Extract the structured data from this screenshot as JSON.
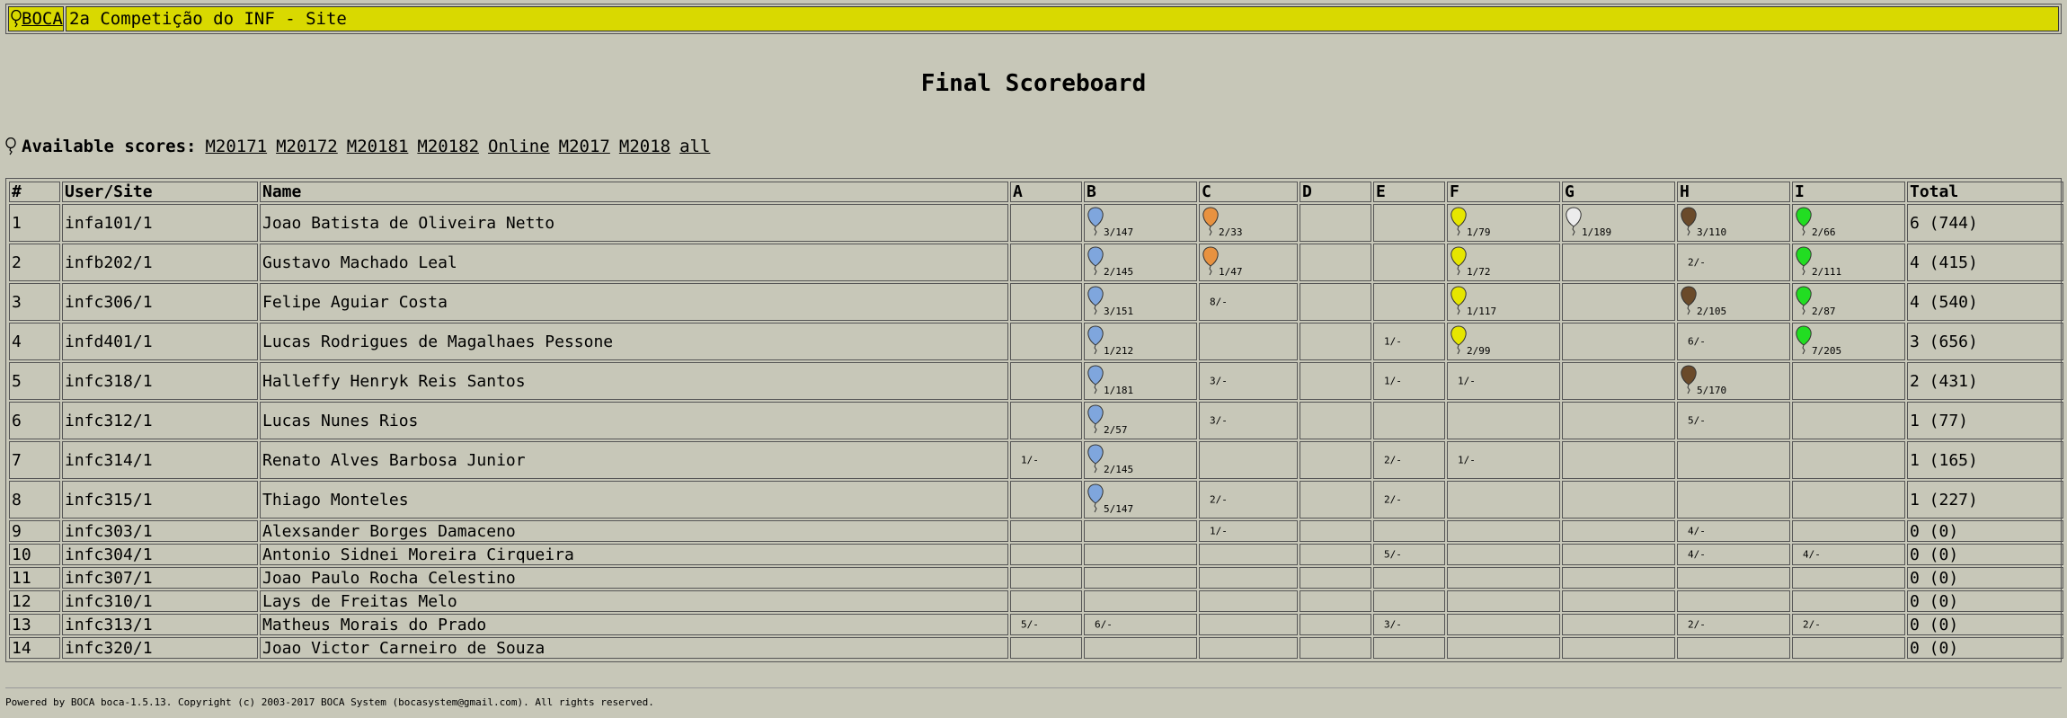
{
  "header": {
    "logo_label": "BOCA",
    "title": "2a Competição do INF - Site"
  },
  "page_title": "Final Scoreboard",
  "scores": {
    "label": "Available scores:",
    "links": [
      "M20171",
      "M20172",
      "M20181",
      "M20182",
      "Online",
      "M2017",
      "M2018",
      "all"
    ]
  },
  "colors": {
    "background": "#c7c7b8",
    "header_bar": "#d9d900",
    "B": "#7fa6dd",
    "C": "#e89240",
    "F": "#e6e600",
    "G": "#ececec",
    "H": "#6a4a2a",
    "I": "#22dd22"
  },
  "table": {
    "headers": [
      "#",
      "User/Site",
      "Name",
      "A",
      "B",
      "C",
      "D",
      "E",
      "F",
      "G",
      "H",
      "I",
      "Total"
    ],
    "problems": [
      "A",
      "B",
      "C",
      "D",
      "E",
      "F",
      "G",
      "H",
      "I"
    ],
    "rows": [
      {
        "rank": "1",
        "user": "infa101/1",
        "name": "Joao Batista de Oliveira Netto",
        "tall": true,
        "total": "6 (744)",
        "p": {
          "B": {
            "t": "3/147",
            "b": true
          },
          "C": {
            "t": "2/33",
            "b": true
          },
          "F": {
            "t": "1/79",
            "b": true
          },
          "G": {
            "t": "1/189",
            "b": true
          },
          "H": {
            "t": "3/110",
            "b": true
          },
          "I": {
            "t": "2/66",
            "b": true
          }
        }
      },
      {
        "rank": "2",
        "user": "infb202/1",
        "name": "Gustavo Machado Leal",
        "tall": true,
        "total": "4 (415)",
        "p": {
          "B": {
            "t": "2/145",
            "b": true
          },
          "C": {
            "t": "1/47",
            "b": true
          },
          "F": {
            "t": "1/72",
            "b": true
          },
          "H": {
            "t": "2/-",
            "b": false
          },
          "I": {
            "t": "2/111",
            "b": true
          }
        }
      },
      {
        "rank": "3",
        "user": "infc306/1",
        "name": "Felipe Aguiar Costa",
        "tall": true,
        "total": "4 (540)",
        "p": {
          "B": {
            "t": "3/151",
            "b": true
          },
          "C": {
            "t": "8/-",
            "b": false
          },
          "F": {
            "t": "1/117",
            "b": true
          },
          "H": {
            "t": "2/105",
            "b": true
          },
          "I": {
            "t": "2/87",
            "b": true
          }
        }
      },
      {
        "rank": "4",
        "user": "infd401/1",
        "name": "Lucas Rodrigues de Magalhaes Pessone",
        "tall": true,
        "total": "3 (656)",
        "p": {
          "B": {
            "t": "1/212",
            "b": true
          },
          "E": {
            "t": "1/-",
            "b": false
          },
          "F": {
            "t": "2/99",
            "b": true
          },
          "H": {
            "t": "6/-",
            "b": false
          },
          "I": {
            "t": "7/205",
            "b": true
          }
        }
      },
      {
        "rank": "5",
        "user": "infc318/1",
        "name": "Halleffy Henryk Reis Santos",
        "tall": true,
        "total": "2 (431)",
        "p": {
          "B": {
            "t": "1/181",
            "b": true
          },
          "C": {
            "t": "3/-",
            "b": false
          },
          "E": {
            "t": "1/-",
            "b": false
          },
          "F": {
            "t": "1/-",
            "b": false
          },
          "H": {
            "t": "5/170",
            "b": true
          }
        }
      },
      {
        "rank": "6",
        "user": "infc312/1",
        "name": "Lucas Nunes Rios",
        "tall": true,
        "total": "1 (77)",
        "p": {
          "B": {
            "t": "2/57",
            "b": true
          },
          "C": {
            "t": "3/-",
            "b": false
          },
          "H": {
            "t": "5/-",
            "b": false
          }
        }
      },
      {
        "rank": "7",
        "user": "infc314/1",
        "name": "Renato Alves Barbosa Junior",
        "tall": true,
        "total": "1 (165)",
        "p": {
          "A": {
            "t": "1/-",
            "b": false
          },
          "B": {
            "t": "2/145",
            "b": true
          },
          "E": {
            "t": "2/-",
            "b": false
          },
          "F": {
            "t": "1/-",
            "b": false
          }
        }
      },
      {
        "rank": "8",
        "user": "infc315/1",
        "name": "Thiago Monteles",
        "tall": true,
        "total": "1 (227)",
        "p": {
          "B": {
            "t": "5/147",
            "b": true
          },
          "C": {
            "t": "2/-",
            "b": false
          },
          "E": {
            "t": "2/-",
            "b": false
          }
        }
      },
      {
        "rank": "9",
        "user": "infc303/1",
        "name": "Alexsander Borges Damaceno",
        "tall": false,
        "total": "0 (0)",
        "p": {
          "C": {
            "t": "1/-",
            "b": false
          },
          "H": {
            "t": "4/-",
            "b": false
          }
        }
      },
      {
        "rank": "10",
        "user": "infc304/1",
        "name": "Antonio Sidnei Moreira Cirqueira",
        "tall": false,
        "total": "0 (0)",
        "p": {
          "E": {
            "t": "5/-",
            "b": false
          },
          "H": {
            "t": "4/-",
            "b": false
          },
          "I": {
            "t": "4/-",
            "b": false
          }
        }
      },
      {
        "rank": "11",
        "user": "infc307/1",
        "name": "Joao Paulo Rocha Celestino",
        "tall": false,
        "total": "0 (0)",
        "p": {}
      },
      {
        "rank": "12",
        "user": "infc310/1",
        "name": "Lays de Freitas Melo",
        "tall": false,
        "total": "0 (0)",
        "p": {}
      },
      {
        "rank": "13",
        "user": "infc313/1",
        "name": "Matheus Morais do Prado",
        "tall": false,
        "total": "0 (0)",
        "p": {
          "A": {
            "t": "5/-",
            "b": false
          },
          "B": {
            "t": "6/-",
            "b": false
          },
          "E": {
            "t": "3/-",
            "b": false
          },
          "H": {
            "t": "2/-",
            "b": false
          },
          "I": {
            "t": "2/-",
            "b": false
          }
        }
      },
      {
        "rank": "14",
        "user": "infc320/1",
        "name": "Joao Victor Carneiro de Souza",
        "tall": false,
        "total": "0 (0)",
        "p": {}
      }
    ]
  },
  "footer": "Powered by BOCA boca-1.5.13. Copyright (c) 2003-2017 BOCA System (bocasystem@gmail.com). All rights reserved."
}
